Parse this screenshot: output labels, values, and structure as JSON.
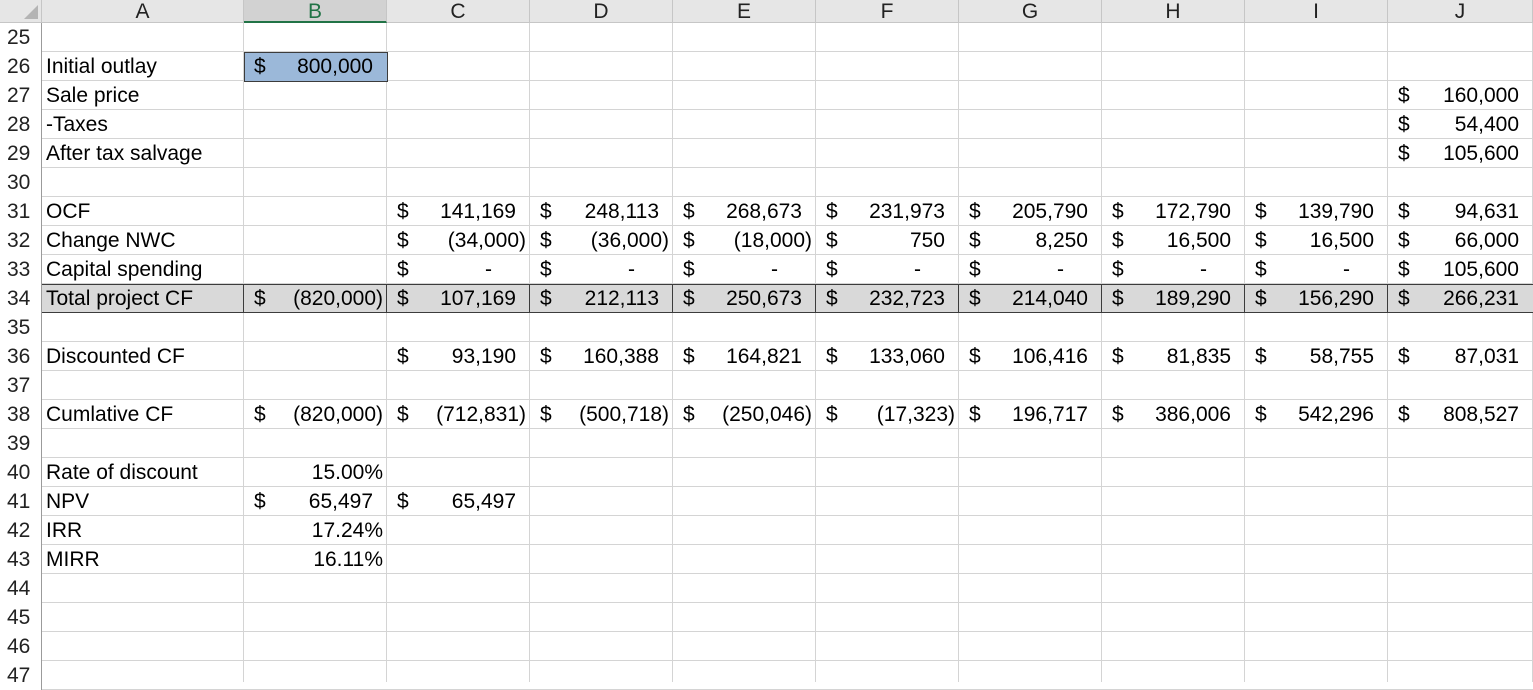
{
  "columns": [
    "A",
    "B",
    "C",
    "D",
    "E",
    "F",
    "G",
    "H",
    "I",
    "J"
  ],
  "selected_column": "B",
  "rows": [
    "25",
    "26",
    "27",
    "28",
    "29",
    "30",
    "31",
    "32",
    "33",
    "34",
    "35",
    "36",
    "37",
    "38",
    "39",
    "40",
    "41",
    "42",
    "43",
    "44",
    "45",
    "46",
    "47"
  ],
  "currency": "$",
  "labels": {
    "r26": "Initial outlay",
    "r27": "Sale price",
    "r28": "-Taxes",
    "r29": "After tax salvage",
    "r31": "OCF",
    "r32": "Change NWC",
    "r33": "Capital spending",
    "r34": "Total project CF",
    "r36": "Discounted CF",
    "r38": "Cumlative CF",
    "r40": "Rate of discount",
    "r41": "NPV",
    "r42": "IRR",
    "r43": "MIRR"
  },
  "values": {
    "B26": "800,000",
    "J27": "160,000",
    "J28": "54,400",
    "J29": "105,600",
    "ocf": [
      "141,169",
      "248,113",
      "268,673",
      "231,973",
      "205,790",
      "172,790",
      "139,790",
      "94,631"
    ],
    "nwc": [
      "(34,000)",
      "(36,000)",
      "(18,000)",
      "750",
      "8,250",
      "16,500",
      "16,500",
      "66,000"
    ],
    "capex": [
      "-",
      "-",
      "-",
      "-",
      "-",
      "-",
      "-",
      "105,600"
    ],
    "total_B": "(820,000)",
    "total": [
      "107,169",
      "212,113",
      "250,673",
      "232,723",
      "214,040",
      "189,290",
      "156,290",
      "266,231"
    ],
    "discounted": [
      "93,190",
      "160,388",
      "164,821",
      "133,060",
      "106,416",
      "81,835",
      "58,755",
      "87,031"
    ],
    "cum_B": "(820,000)",
    "cum": [
      "(712,831)",
      "(500,718)",
      "(250,046)",
      "(17,323)",
      "196,717",
      "386,006",
      "542,296",
      "808,527"
    ],
    "rate": "15.00%",
    "npv": "65,497",
    "npv_C": "65,497",
    "irr": "17.24%",
    "mirr": "16.11%"
  }
}
